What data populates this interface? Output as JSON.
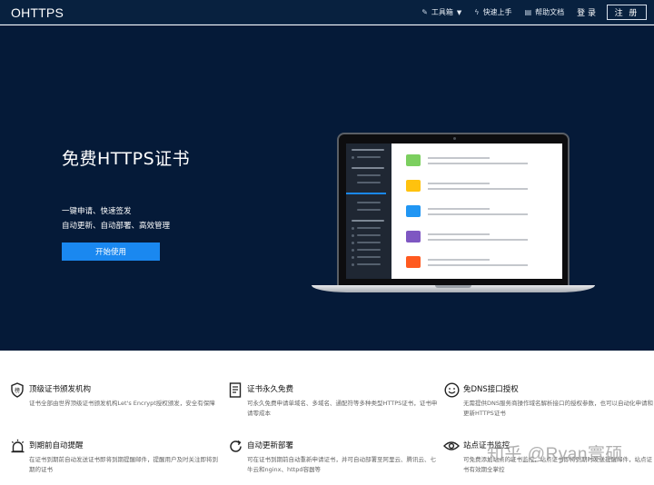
{
  "nav": {
    "brand": "OHTTPS",
    "items": [
      {
        "label": "工具箱",
        "icon": "wrench-icon"
      },
      {
        "label": "快速上手",
        "icon": "bolt-icon"
      },
      {
        "label": "帮助文档",
        "icon": "document-icon"
      }
    ],
    "login": "登 录",
    "signup": "注 册"
  },
  "hero": {
    "title": "免费HTTPS证书",
    "line1": "一键申请、快速签发",
    "line2": "自动更新、自动部署、高效管理",
    "cta": "开始使用"
  },
  "mock_screen": {
    "colors": [
      "#7ccf5f",
      "#ffc20e",
      "#2196f3",
      "#7e57c2",
      "#ff5a1f"
    ]
  },
  "features": [
    {
      "title": "顶级证书颁发机构",
      "desc": "证书全部由世界顶级证书颁发机构Let's Encrypt授权颁发，安全有保障",
      "icon": "badge-icon"
    },
    {
      "title": "证书永久免费",
      "desc": "可永久免费申请单域名、多域名、通配符等多种类型HTTPS证书，证书申请零成本",
      "icon": "certificate-icon"
    },
    {
      "title": "免DNS接口授权",
      "desc": "无需提供DNS服务商操作域名解析接口的授权参数，也可以自动化申请和更新HTTPS证书",
      "icon": "smile-icon"
    },
    {
      "title": "到期前自动提醒",
      "desc": "在证书到期前自动发送证书即将到期提醒邮件，提醒用户及时关注即将到期的证书",
      "icon": "alarm-icon"
    },
    {
      "title": "自动更新部署",
      "desc": "可在证书到期前自动重新申请证书，并可自动部署至阿里云、腾讯云、七牛云和nginx、httpd容器等",
      "icon": "refresh-icon"
    },
    {
      "title": "站点证书监控",
      "desc": "可免费添加站点的证书监控，站点证书即将到期时发送提醒邮件，站点证书有效期全掌控",
      "icon": "eye-icon"
    }
  ],
  "watermark": "知乎 @Ryan寰硕"
}
